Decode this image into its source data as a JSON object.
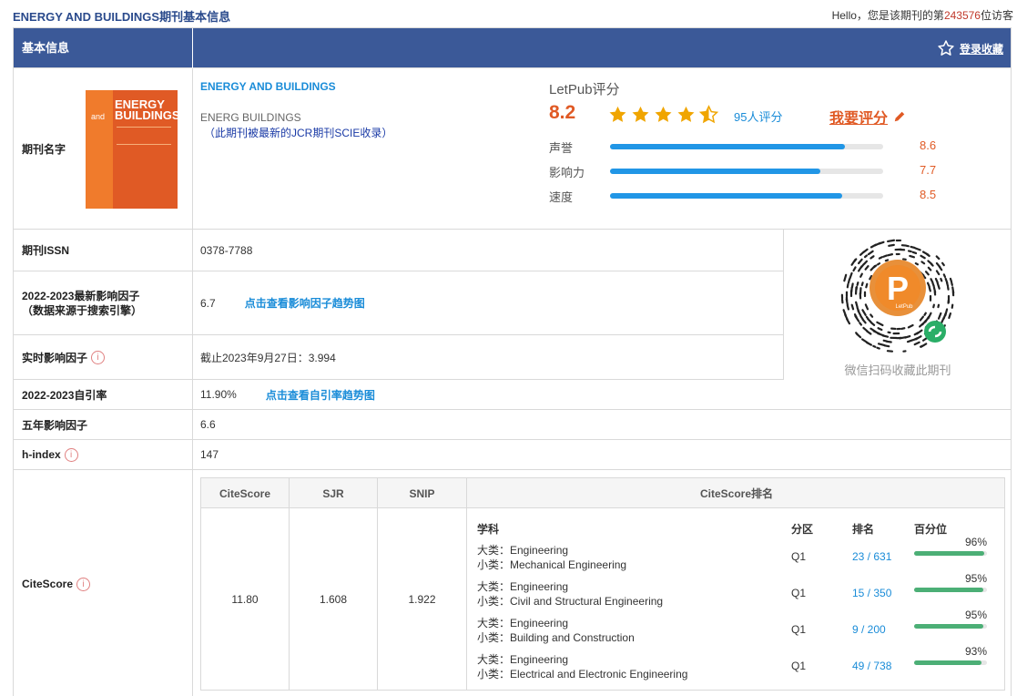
{
  "page": {
    "title": "ENERGY AND BUILDINGS期刊基本信息",
    "greeting_prefix": "Hello，您是该期刊的第",
    "visitor_count": "243576",
    "greeting_suffix": "位访客"
  },
  "header": {
    "section_label": "基本信息",
    "favorite_label": "登录收藏"
  },
  "journal": {
    "name_label": "期刊名字",
    "cover_title": "ENERGY BUILDINGS",
    "cover_and": "and",
    "name": "ENERGY AND BUILDINGS",
    "abbr": "ENERG BUILDINGS",
    "note": "（此期刊被最新的JCR期刊SCIE收录）"
  },
  "rating": {
    "title": "LetPub评分",
    "score": "8.2",
    "stars": 4.5,
    "reviews": "95人评分",
    "rate_me": "我要评分",
    "bars": [
      {
        "label": "声誉",
        "value": "8.6",
        "fraction": 0.86
      },
      {
        "label": "影响力",
        "value": "7.7",
        "fraction": 0.77
      },
      {
        "label": "速度",
        "value": "8.5",
        "fraction": 0.85
      }
    ]
  },
  "rows": {
    "issn_label": "期刊ISSN",
    "issn": "0378-7788",
    "if_label_1": "2022-2023最新影响因子",
    "if_label_2": "（数据来源于搜索引擎）",
    "if_value": "6.7",
    "if_link": "点击查看影响因子趋势图",
    "rt_label": "实时影响因子",
    "rt_value": "截止2023年9月27日：3.994",
    "self_label": "2022-2023自引率",
    "self_value": "11.90%",
    "self_link": "点击查看自引率趋势图",
    "five_label": "五年影响因子",
    "five_value": "6.6",
    "h_label": "h-index",
    "h_value": "147",
    "cs_label": "CiteScore"
  },
  "qr": {
    "caption": "微信扫码收藏此期刊",
    "logo_letter": "P",
    "logo_text": "LetPub"
  },
  "citescore": {
    "headers": {
      "citescore": "CiteScore",
      "sjr": "SJR",
      "snip": "SNIP",
      "rank": "CiteScore排名"
    },
    "citescore": "11.80",
    "sjr": "1.608",
    "snip": "1.922",
    "rank_headers": {
      "subject": "学科",
      "quartile": "分区",
      "rank": "排名",
      "percentile": "百分位"
    },
    "ranks": [
      {
        "major": "大类：Engineering",
        "minor": "小类：Mechanical Engineering",
        "quartile": "Q1",
        "rank": "23 / 631",
        "percentile": "96%",
        "pct": 96
      },
      {
        "major": "大类：Engineering",
        "minor": "小类：Civil and Structural Engineering",
        "quartile": "Q1",
        "rank": "15 / 350",
        "percentile": "95%",
        "pct": 95
      },
      {
        "major": "大类：Engineering",
        "minor": "小类：Building and Construction",
        "quartile": "Q1",
        "rank": "9 / 200",
        "percentile": "95%",
        "pct": 95
      },
      {
        "major": "大类：Engineering",
        "minor": "小类：Electrical and Electronic Engineering",
        "quartile": "Q1",
        "rank": "49 / 738",
        "percentile": "93%",
        "pct": 93
      }
    ]
  },
  "colors": {
    "header_bg": "#3b5998",
    "accent": "#e05a25",
    "link": "#1a8cd8",
    "bar": "#2196e6",
    "pct_bar": "#4caf76"
  }
}
